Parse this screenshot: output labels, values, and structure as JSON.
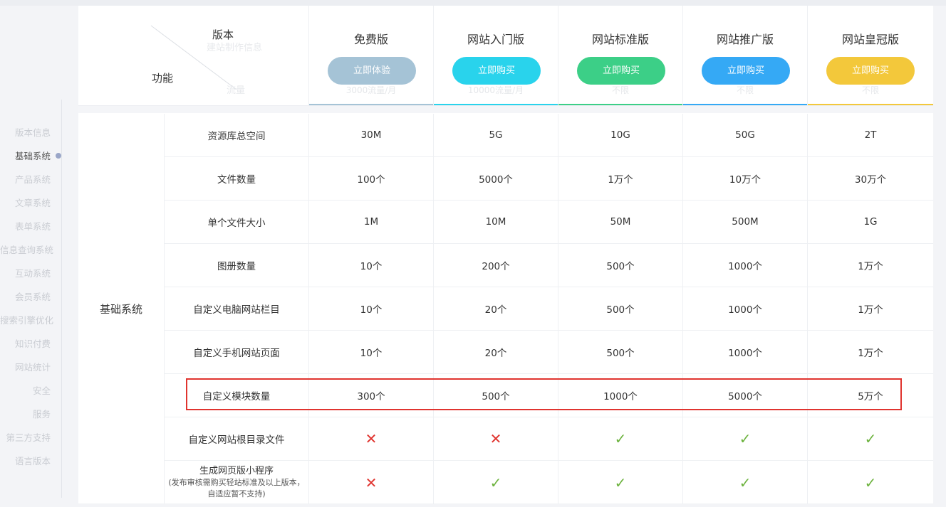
{
  "nav": {
    "items": [
      {
        "label": "版本信息",
        "active": false
      },
      {
        "label": "基础系统",
        "active": true
      },
      {
        "label": "产品系统",
        "active": false
      },
      {
        "label": "文章系统",
        "active": false
      },
      {
        "label": "表单系统",
        "active": false
      },
      {
        "label": "信息查询系统",
        "active": false
      },
      {
        "label": "互动系统",
        "active": false
      },
      {
        "label": "会员系统",
        "active": false
      },
      {
        "label": "搜索引擎优化",
        "active": false
      },
      {
        "label": "知识付费",
        "active": false
      },
      {
        "label": "网站统计",
        "active": false
      },
      {
        "label": "安全",
        "active": false
      },
      {
        "label": "服务",
        "active": false
      },
      {
        "label": "第三方支持",
        "active": false
      },
      {
        "label": "语言版本",
        "active": false
      }
    ]
  },
  "header": {
    "version_label": "版本",
    "feature_label": "功能",
    "ghost_top": "建站制作信息",
    "ghost_bottom": "流量"
  },
  "plans": [
    {
      "name": "免费版",
      "button": "立即体验",
      "color": "#a5c3d6",
      "underline": "#a5c3d6",
      "ghost": "3000流量/月"
    },
    {
      "name": "网站入门版",
      "button": "立即购买",
      "color": "#29d3ec",
      "underline": "#29d3ec",
      "ghost": "10000流量/月"
    },
    {
      "name": "网站标准版",
      "button": "立即购买",
      "color": "#3ccf87",
      "underline": "#3ccf87",
      "ghost": "不限"
    },
    {
      "name": "网站推广版",
      "button": "立即购买",
      "color": "#35a9f5",
      "underline": "#35a9f5",
      "ghost": "不限"
    },
    {
      "name": "网站皇冠版",
      "button": "立即购买",
      "color": "#f3c83b",
      "underline": "#f3c83b",
      "ghost": "不限"
    }
  ],
  "category": "基础系统",
  "rows": [
    {
      "name": "资源库总空间",
      "values": [
        "30M",
        "5G",
        "10G",
        "50G",
        "2T"
      ]
    },
    {
      "name": "文件数量",
      "values": [
        "100个",
        "5000个",
        "1万个",
        "10万个",
        "30万个"
      ]
    },
    {
      "name": "单个文件大小",
      "values": [
        "1M",
        "10M",
        "50M",
        "500M",
        "1G"
      ]
    },
    {
      "name": "图册数量",
      "values": [
        "10个",
        "200个",
        "500个",
        "1000个",
        "1万个"
      ]
    },
    {
      "name": "自定义电脑网站栏目",
      "values": [
        "10个",
        "20个",
        "500个",
        "1000个",
        "1万个"
      ]
    },
    {
      "name": "自定义手机网站页面",
      "values": [
        "10个",
        "20个",
        "500个",
        "1000个",
        "1万个"
      ]
    },
    {
      "name": "自定义模块数量",
      "values": [
        "300个",
        "500个",
        "1000个",
        "5000个",
        "5万个"
      ]
    },
    {
      "name": "自定义网站根目录文件",
      "values": [
        "✕",
        "✕",
        "✓",
        "✓",
        "✓"
      ]
    },
    {
      "name": "生成网页版小程序",
      "sub": "(发布审核需购买轻站标准及以上版本，自适应暂不支持)",
      "values": [
        "✕",
        "✓",
        "✓",
        "✓",
        "✓"
      ]
    }
  ]
}
